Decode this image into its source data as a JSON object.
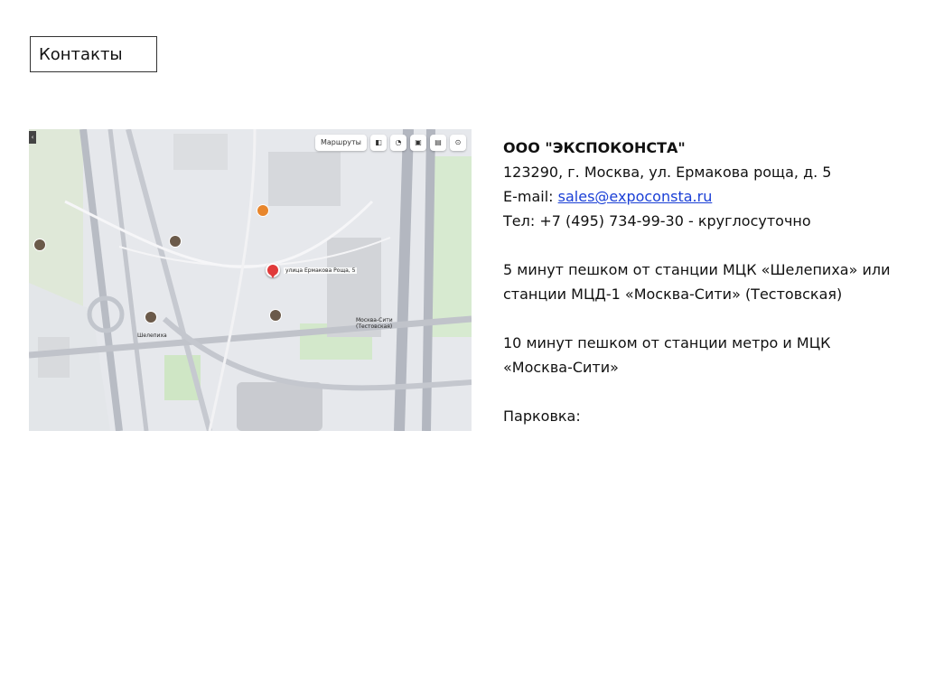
{
  "slide": {
    "title": "Контакты"
  },
  "map": {
    "toolbar": {
      "route_label": "Маршруты"
    },
    "labels": {
      "destination": "улица Ермакова Роща, 5",
      "moskva_siti": "Москва-Сити",
      "testovskaya": "(Тестовская)",
      "shelepikha": "Шелепиха"
    }
  },
  "contacts": {
    "company": "ООО \"ЭКСПОКОНСТА\"",
    "address": "123290, г. Москва, ул. Ермакова роща, д. 5",
    "email_prefix": "E-mail: ",
    "email": "sales@expoconsta.ru",
    "phone": "Тел: +7 (495) 734-99-30 - круглосуточно",
    "directions_1": "5 минут пешком от станции МЦК «Шелепиха» или станции МЦД-1 «Москва-Сити» (Тестовская)",
    "directions_2": "10 минут пешком от станции метро и МЦК «Москва-Сити»",
    "parking": "Парковка:"
  },
  "colors": {
    "link": "#1a3fd6",
    "pin": "#e03a3a"
  }
}
